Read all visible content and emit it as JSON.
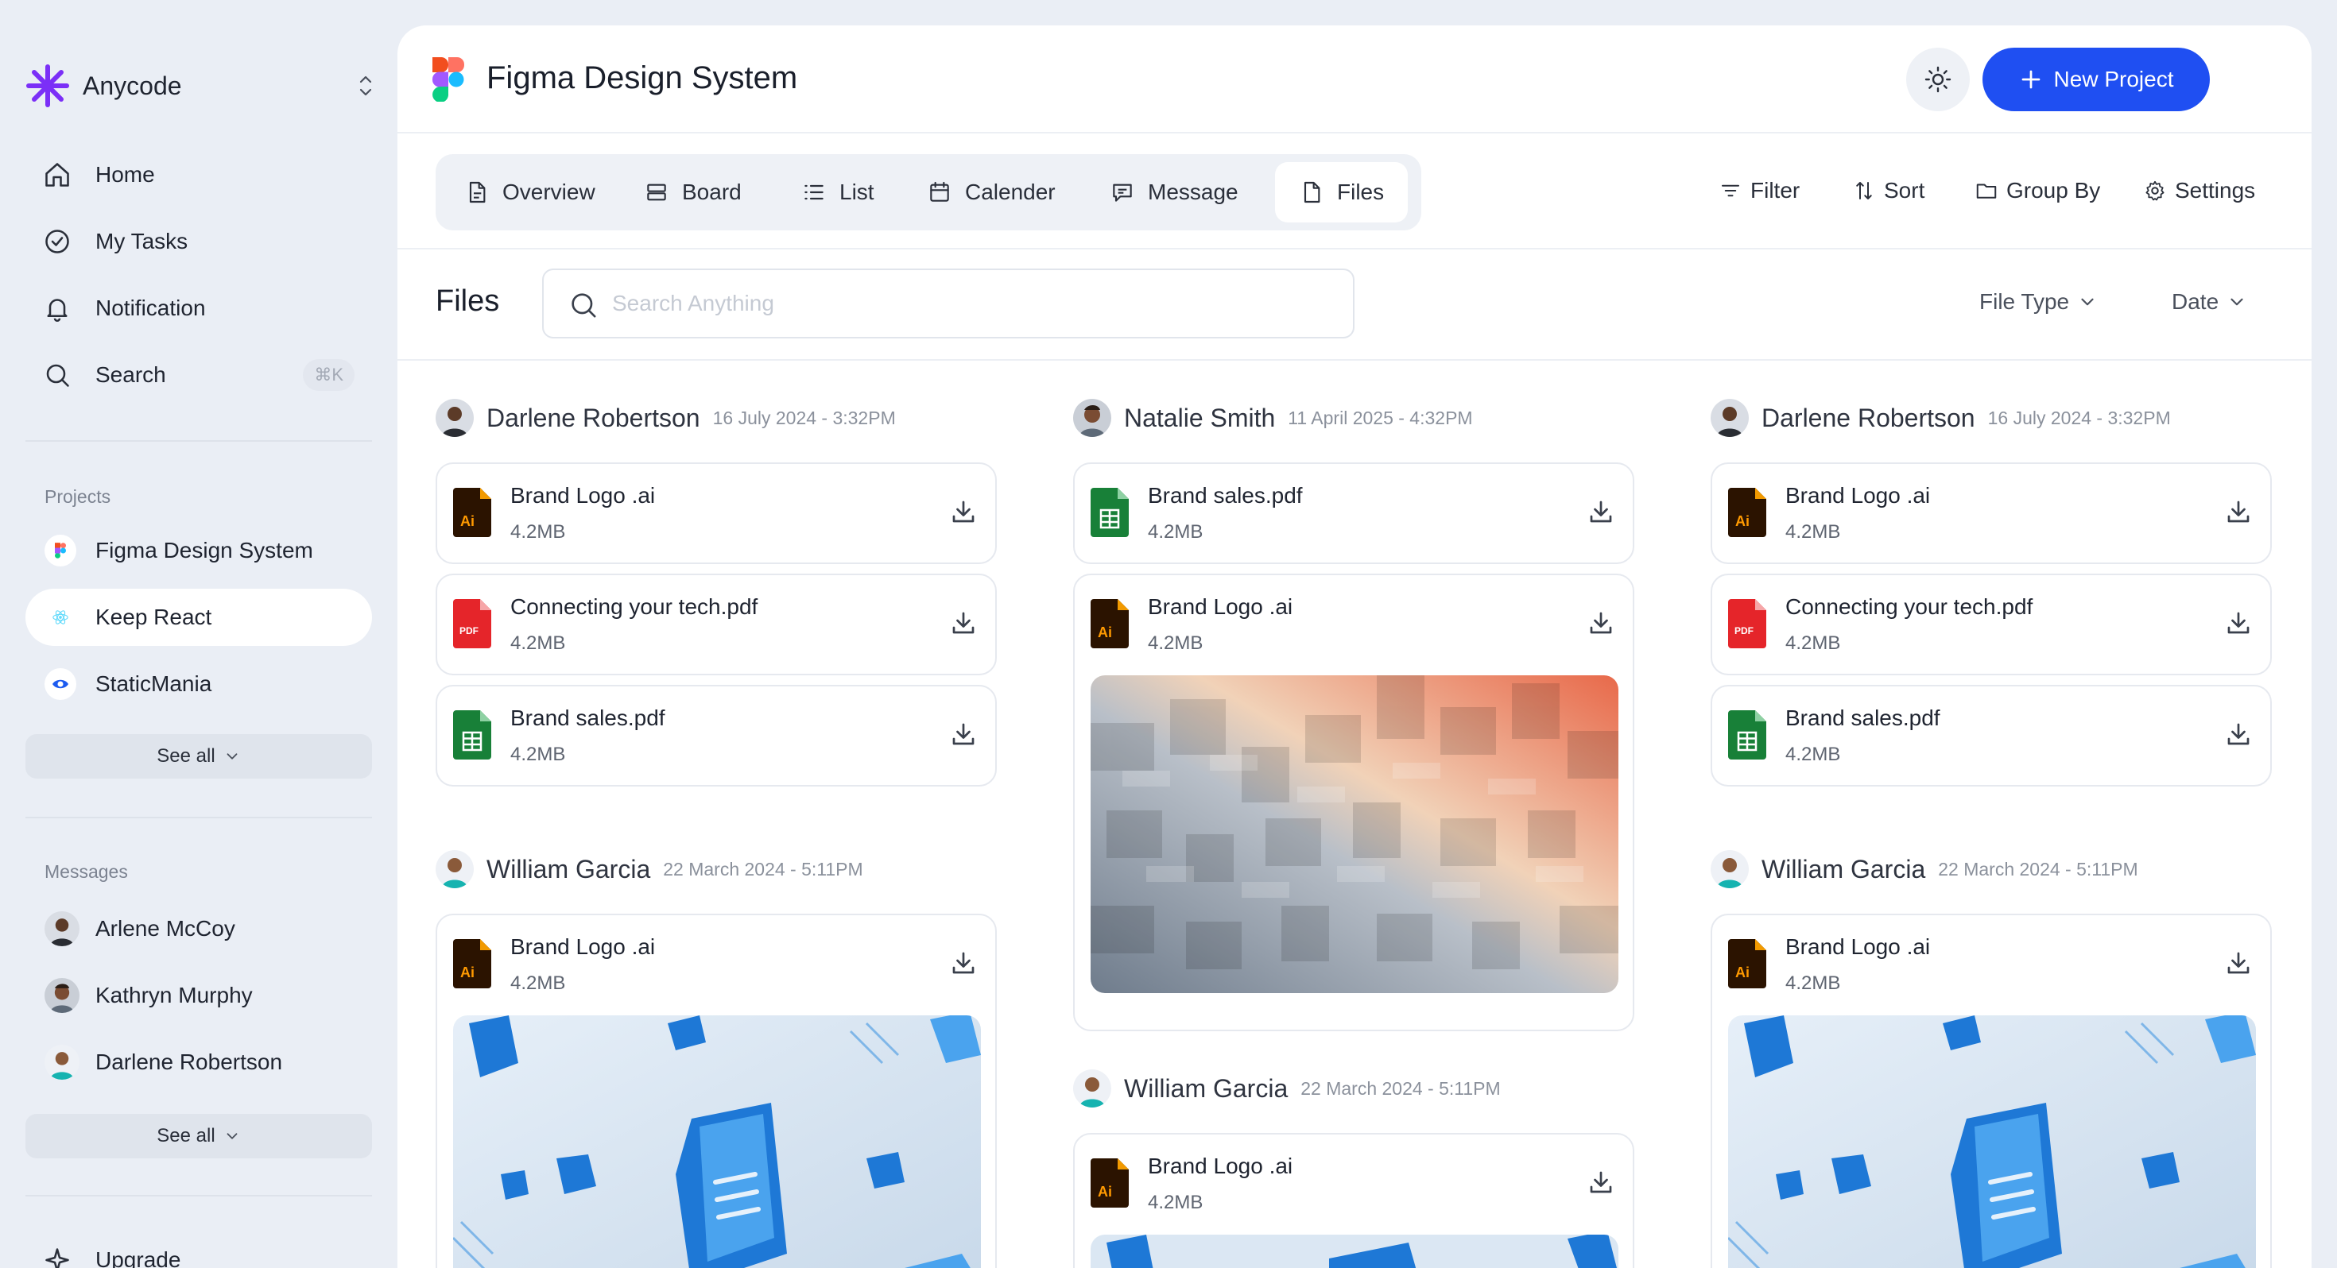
{
  "app": {
    "name": "Anycode",
    "brand_color": "#7b2ff7"
  },
  "nav": {
    "home": "Home",
    "tasks": "My Tasks",
    "notification": "Notification",
    "search": "Search",
    "search_shortcut": "⌘K"
  },
  "projects": {
    "label": "Projects",
    "items": [
      "Figma Design System",
      "Keep React",
      "StaticMania"
    ],
    "active": "Keep React",
    "see_all": "See all"
  },
  "messages": {
    "label": "Messages",
    "items": [
      "Arlene McCoy",
      "Kathryn Murphy",
      "Darlene Robertson"
    ],
    "see_all": "See all"
  },
  "upgrade": "Upgrade",
  "header": {
    "title": "Figma Design System",
    "new_project": "New Project",
    "accent": "#1f4ff2"
  },
  "tabs": [
    "Overview",
    "Board",
    "List",
    "Calender",
    "Message",
    "Files"
  ],
  "active_tab": "Files",
  "tools": {
    "filter": "Filter",
    "sort": "Sort",
    "group_by": "Group By",
    "settings": "Settings"
  },
  "files": {
    "title": "Files",
    "search_placeholder": "Search Anything",
    "file_type": "File Type",
    "date": "Date"
  },
  "groups": [
    {
      "user": "Darlene Robertson",
      "date": "16 July 2024 - 3:32PM",
      "files": [
        {
          "name": "Brand Logo .ai",
          "size": "4.2MB",
          "type": "ai-icon"
        },
        {
          "name": "Connecting your tech.pdf",
          "size": "4.2MB",
          "type": "pdf-icon"
        },
        {
          "name": "Brand sales.pdf",
          "size": "4.2MB",
          "type": "sheet-icon"
        }
      ]
    },
    {
      "user": "William Garcia",
      "date": "22 March 2024 - 5:11PM",
      "files": [
        {
          "name": "Brand Logo .ai",
          "size": "4.2MB",
          "type": "ai-icon"
        }
      ]
    },
    {
      "user": "Natalie Smith",
      "date": "11 April 2025 - 4:32PM",
      "files": [
        {
          "name": "Brand sales.pdf",
          "size": "4.2MB",
          "type": "sheet-icon"
        },
        {
          "name": "Brand Logo .ai",
          "size": "4.2MB",
          "type": "ai-icon"
        }
      ]
    },
    {
      "user": "William Garcia",
      "date": "22 March 2024 - 5:11PM",
      "files": [
        {
          "name": "Brand Logo .ai",
          "size": "4.2MB",
          "type": "ai-icon"
        }
      ]
    },
    {
      "user": "Darlene Robertson",
      "date": "16 July 2024 - 3:32PM",
      "files": [
        {
          "name": "Brand Logo .ai",
          "size": "4.2MB",
          "type": "ai-icon"
        },
        {
          "name": "Connecting your tech.pdf",
          "size": "4.2MB",
          "type": "pdf-icon"
        },
        {
          "name": "Brand sales.pdf",
          "size": "4.2MB",
          "type": "sheet-icon"
        }
      ]
    },
    {
      "user": "William Garcia",
      "date": "22 March 2024 - 5:11PM",
      "files": [
        {
          "name": "Brand Logo .ai",
          "size": "4.2MB",
          "type": "ai-icon"
        }
      ]
    }
  ]
}
